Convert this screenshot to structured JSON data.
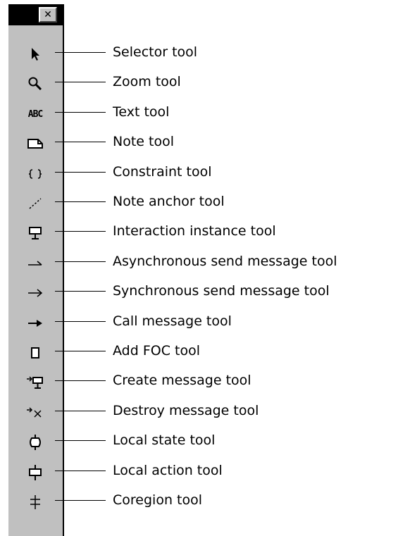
{
  "palette": {
    "close_glyph": "✕",
    "tools": [
      {
        "icon": "selector-arrow-icon",
        "label": "Selector tool"
      },
      {
        "icon": "magnifier-icon",
        "label": "Zoom tool"
      },
      {
        "icon": "abc-text-icon",
        "icon_text": "ABC",
        "label": "Text tool"
      },
      {
        "icon": "note-icon",
        "label": "Note tool"
      },
      {
        "icon": "braces-icon",
        "label": "Constraint tool"
      },
      {
        "icon": "dashed-line-icon",
        "label": "Note anchor tool"
      },
      {
        "icon": "interaction-instance-icon",
        "label": "Interaction instance tool"
      },
      {
        "icon": "half-arrow-icon",
        "label": "Asynchronous send message tool"
      },
      {
        "icon": "open-arrow-icon",
        "label": "Synchronous send message tool"
      },
      {
        "icon": "filled-arrow-icon",
        "label": "Call message tool"
      },
      {
        "icon": "rectangle-icon",
        "label": "Add FOC tool"
      },
      {
        "icon": "create-message-icon",
        "label": "Create message tool"
      },
      {
        "icon": "destroy-message-icon",
        "label": "Destroy message tool"
      },
      {
        "icon": "local-state-icon",
        "label": "Local state tool"
      },
      {
        "icon": "local-action-icon",
        "label": "Local action tool"
      },
      {
        "icon": "coregion-icon",
        "label": "Coregion tool"
      }
    ]
  }
}
